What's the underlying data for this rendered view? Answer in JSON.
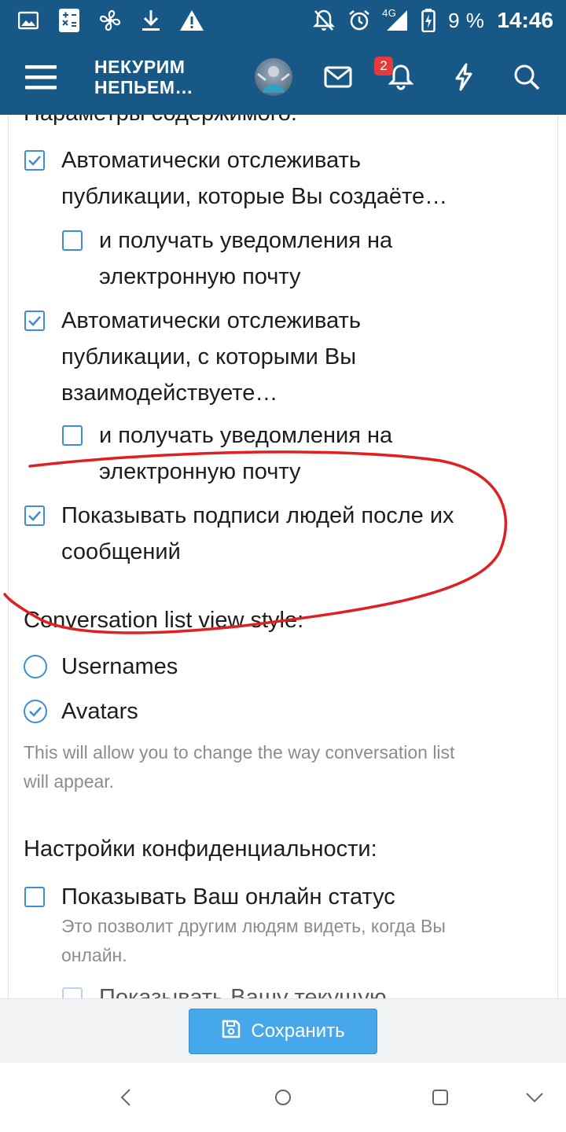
{
  "status_bar": {
    "icons_left": [
      "gallery-icon",
      "calculator-icon",
      "fan-icon",
      "download-icon",
      "warning-icon"
    ],
    "icons_right": [
      "notifications-off-icon",
      "alarm-icon",
      "signal-4g-icon",
      "battery-charging-icon"
    ],
    "network": "4G",
    "battery": "9 %",
    "time": "14:46"
  },
  "header": {
    "logo_line1": "НЕКУРИМ",
    "logo_line2": "НЕПЬЕМ…",
    "notification_count": "2",
    "colors": {
      "bar": "#185886",
      "badge": "#e53b3b"
    }
  },
  "content_section": {
    "title": "Параметры содержимого:",
    "options": [
      {
        "label_line1": "Автоматически отслеживать",
        "label_line2": "публикации, которые Вы создаёте…",
        "checked": true
      },
      {
        "label_line1": "и получать уведомления на",
        "label_line2": "электронную почту",
        "checked": false
      },
      {
        "label_line1": "Автоматически отслеживать",
        "label_line2": "публикации, с которыми Вы",
        "label_line3": "взаимодействуете…",
        "checked": true
      },
      {
        "label_line1": "и получать уведомления на",
        "label_line2": "электронную почту",
        "checked": false
      },
      {
        "label_line1": "Показывать подписи людей после их",
        "label_line2": "сообщений",
        "checked": true
      }
    ]
  },
  "conversation_section": {
    "title": "Conversation list view style:",
    "options": [
      {
        "label": "Usernames",
        "selected": false
      },
      {
        "label": "Avatars",
        "selected": true
      }
    ],
    "hint_line1": "This will allow you to change the way conversation list",
    "hint_line2": "will appear."
  },
  "privacy_section": {
    "title": "Настройки конфиденциальности:",
    "online_status": {
      "label": "Показывать Ваш онлайн статус",
      "checked": false,
      "hint_line1": "Это позволит другим людям видеть, когда Вы",
      "hint_line2": "онлайн."
    },
    "partial_option": "Показывать Вашу текущую"
  },
  "footer": {
    "save_label": "Сохранить",
    "accent": "#47a7eb"
  },
  "annotation": {
    "color": "#e02020"
  }
}
